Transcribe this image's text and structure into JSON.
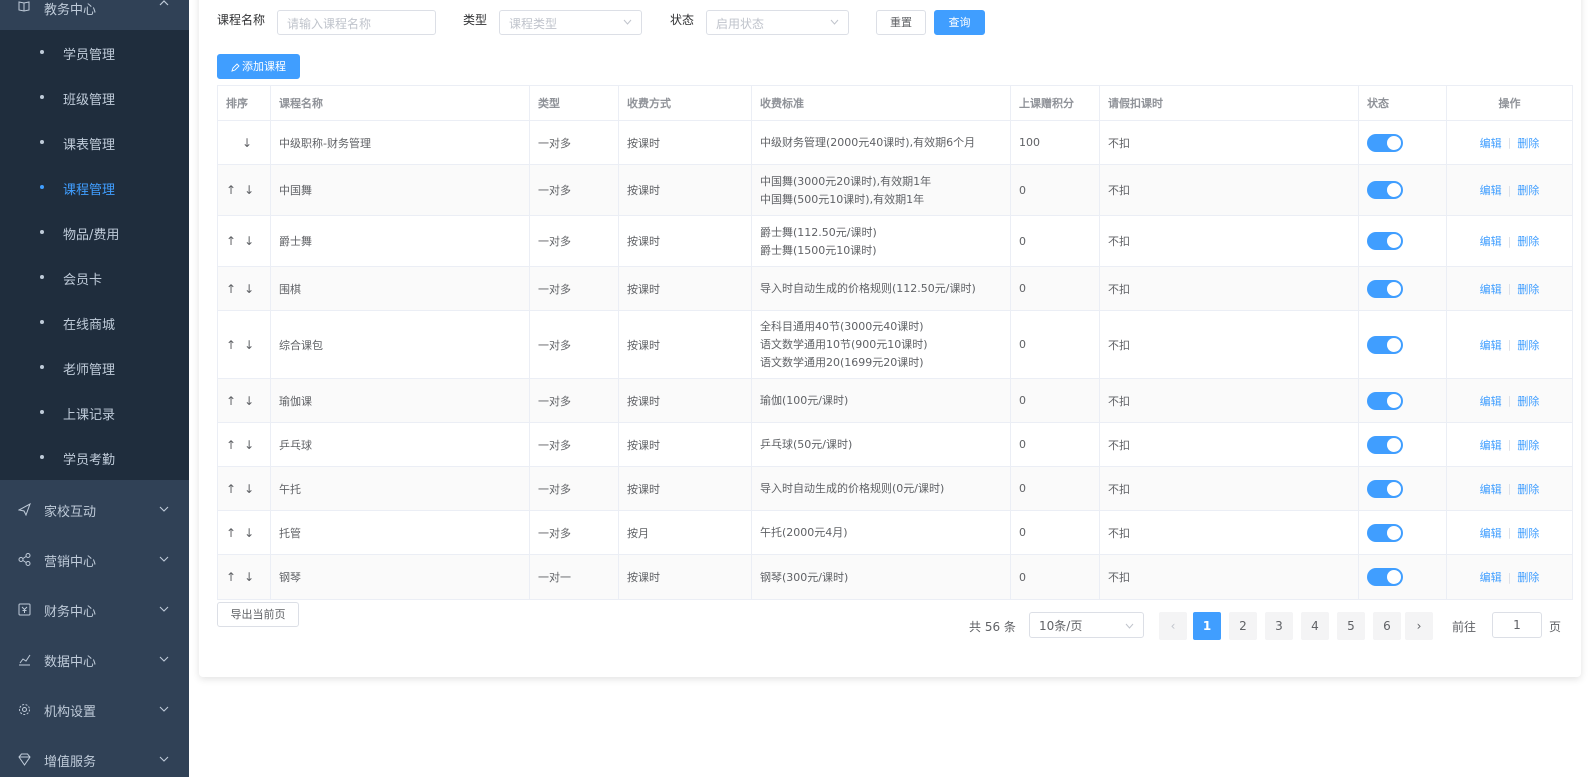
{
  "sidebar": {
    "top_label": "教务中心",
    "sub_items": [
      {
        "label": "学员管理",
        "active": false
      },
      {
        "label": "班级管理",
        "active": false
      },
      {
        "label": "课表管理",
        "active": false
      },
      {
        "label": "课程管理",
        "active": true
      },
      {
        "label": "物品/费用",
        "active": false
      },
      {
        "label": "会员卡",
        "active": false
      },
      {
        "label": "在线商城",
        "active": false
      },
      {
        "label": "老师管理",
        "active": false
      },
      {
        "label": "上课记录",
        "active": false
      },
      {
        "label": "学员考勤",
        "active": false
      }
    ],
    "groups": [
      {
        "label": "家校互动",
        "icon": "send-icon"
      },
      {
        "label": "营销中心",
        "icon": "share-icon"
      },
      {
        "label": "财务中心",
        "icon": "finance-icon"
      },
      {
        "label": "数据中心",
        "icon": "chart-icon"
      },
      {
        "label": "机构设置",
        "icon": "gear-icon"
      },
      {
        "label": "增值服务",
        "icon": "diamond-icon"
      }
    ]
  },
  "filters": {
    "name_label": "课程名称",
    "name_placeholder": "请输入课程名称",
    "type_label": "类型",
    "type_placeholder": "课程类型",
    "status_label": "状态",
    "status_placeholder": "启用状态",
    "reset_label": "重置",
    "search_label": "查询"
  },
  "add_button": "添加课程",
  "table": {
    "headers": {
      "sort": "排序",
      "name": "课程名称",
      "type": "类型",
      "charge_mode": "收费方式",
      "charge_standard": "收费标准",
      "points": "上课赠积分",
      "leave": "请假扣课时",
      "status": "状态",
      "ops": "操作"
    },
    "edit_label": "编辑",
    "delete_label": "删除",
    "separator": "|",
    "rows": [
      {
        "name": "中级职称-财务管理",
        "type": "一对多",
        "charge_mode": "按课时",
        "standard": [
          "中级财务管理(2000元40课时),有效期6个月"
        ],
        "points": "100",
        "leave": "不扣",
        "up": false
      },
      {
        "name": "中国舞",
        "type": "一对多",
        "charge_mode": "按课时",
        "standard": [
          "中国舞(3000元20课时),有效期1年",
          "中国舞(500元10课时),有效期1年"
        ],
        "points": "0",
        "leave": "不扣",
        "up": true
      },
      {
        "name": "爵士舞",
        "type": "一对多",
        "charge_mode": "按课时",
        "standard": [
          "爵士舞(112.50元/课时)",
          "爵士舞(1500元10课时)"
        ],
        "points": "0",
        "leave": "不扣",
        "up": true
      },
      {
        "name": "围棋",
        "type": "一对多",
        "charge_mode": "按课时",
        "standard": [
          "导入时自动生成的价格规则(112.50元/课时)"
        ],
        "points": "0",
        "leave": "不扣",
        "up": true
      },
      {
        "name": "综合课包",
        "type": "一对多",
        "charge_mode": "按课时",
        "standard": [
          "全科目通用40节(3000元40课时)",
          "语文数学通用10节(900元10课时)",
          "语文数学通用20(1699元20课时)"
        ],
        "points": "0",
        "leave": "不扣",
        "up": true
      },
      {
        "name": "瑜伽课",
        "type": "一对多",
        "charge_mode": "按课时",
        "standard": [
          "瑜伽(100元/课时)"
        ],
        "points": "0",
        "leave": "不扣",
        "up": true
      },
      {
        "name": "乒乓球",
        "type": "一对多",
        "charge_mode": "按课时",
        "standard": [
          "乒乓球(50元/课时)"
        ],
        "points": "0",
        "leave": "不扣",
        "up": true
      },
      {
        "name": "午托",
        "type": "一对多",
        "charge_mode": "按课时",
        "standard": [
          "导入时自动生成的价格规则(0元/课时)"
        ],
        "points": "0",
        "leave": "不扣",
        "up": true
      },
      {
        "name": "托管",
        "type": "一对多",
        "charge_mode": "按月",
        "standard": [
          "午托(2000元4月)"
        ],
        "points": "0",
        "leave": "不扣",
        "up": true
      },
      {
        "name": "钢琴",
        "type": "一对一",
        "charge_mode": "按课时",
        "standard": [
          "钢琴(300元/课时)"
        ],
        "points": "0",
        "leave": "不扣",
        "up": true
      }
    ]
  },
  "footer": {
    "export_label": "导出当前页",
    "total_text": "共 56 条",
    "page_size": "10条/页",
    "pages": [
      "1",
      "2",
      "3",
      "4",
      "5",
      "6"
    ],
    "current_page": "1",
    "goto_prefix": "前往",
    "goto_value": "1",
    "goto_suffix": "页"
  },
  "colors": {
    "primary": "#409eff",
    "sidebar_bg": "#304156",
    "submenu_bg": "#1f2d3d"
  }
}
